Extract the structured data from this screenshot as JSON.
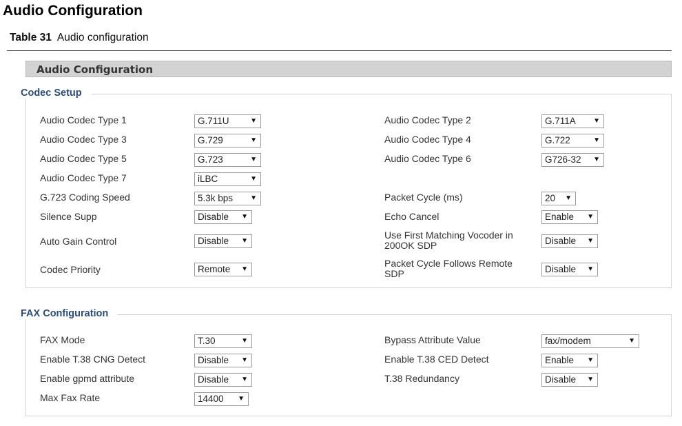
{
  "doc_title": "Audio Configuration",
  "table_caption": {
    "number": "Table 31",
    "text": "Audio configuration"
  },
  "panel_title": "Audio Configuration",
  "codec_setup": {
    "title": "Codec Setup",
    "audio_codec_type_1": {
      "label": "Audio Codec Type 1",
      "value": "G.711U"
    },
    "audio_codec_type_2": {
      "label": "Audio Codec Type 2",
      "value": "G.711A"
    },
    "audio_codec_type_3": {
      "label": "Audio Codec Type 3",
      "value": "G.729"
    },
    "audio_codec_type_4": {
      "label": "Audio Codec Type 4",
      "value": "G.722"
    },
    "audio_codec_type_5": {
      "label": "Audio Codec Type 5",
      "value": "G.723"
    },
    "audio_codec_type_6": {
      "label": "Audio Codec Type 6",
      "value": "G726-32"
    },
    "audio_codec_type_7": {
      "label": "Audio Codec Type 7",
      "value": "iLBC"
    },
    "g723_coding_speed": {
      "label": "G.723 Coding Speed",
      "value": "5.3k bps"
    },
    "packet_cycle": {
      "label": "Packet Cycle (ms)",
      "value": "20"
    },
    "silence_supp": {
      "label": "Silence Supp",
      "value": "Disable"
    },
    "echo_cancel": {
      "label": "Echo Cancel",
      "value": "Enable"
    },
    "auto_gain_control": {
      "label": "Auto Gain Control",
      "value": "Disable"
    },
    "use_first_matching_vocoder": {
      "label_line1": "Use First Matching Vocoder in",
      "label_line2": "200OK SDP",
      "value": "Disable"
    },
    "codec_priority": {
      "label": "Codec Priority",
      "value": "Remote"
    },
    "packet_cycle_follows_remote": {
      "label_line1": "Packet Cycle Follows Remote",
      "label_line2": "SDP",
      "value": "Disable"
    }
  },
  "fax_configuration": {
    "title": "FAX Configuration",
    "fax_mode": {
      "label": "FAX Mode",
      "value": "T.30"
    },
    "bypass_attribute_value": {
      "label": "Bypass Attribute Value",
      "value": "fax/modem"
    },
    "enable_t38_cng_detect": {
      "label": "Enable T.38 CNG Detect",
      "value": "Disable"
    },
    "enable_t38_ced_detect": {
      "label": "Enable T.38 CED Detect",
      "value": "Enable"
    },
    "enable_gpmd_attribute": {
      "label": "Enable gpmd attribute",
      "value": "Disable"
    },
    "t38_redundancy": {
      "label": "T.38 Redundancy",
      "value": "Disable"
    },
    "max_fax_rate": {
      "label": "Max Fax Rate",
      "value": "14400"
    }
  },
  "dropdown_arrow_glyph": "▼"
}
